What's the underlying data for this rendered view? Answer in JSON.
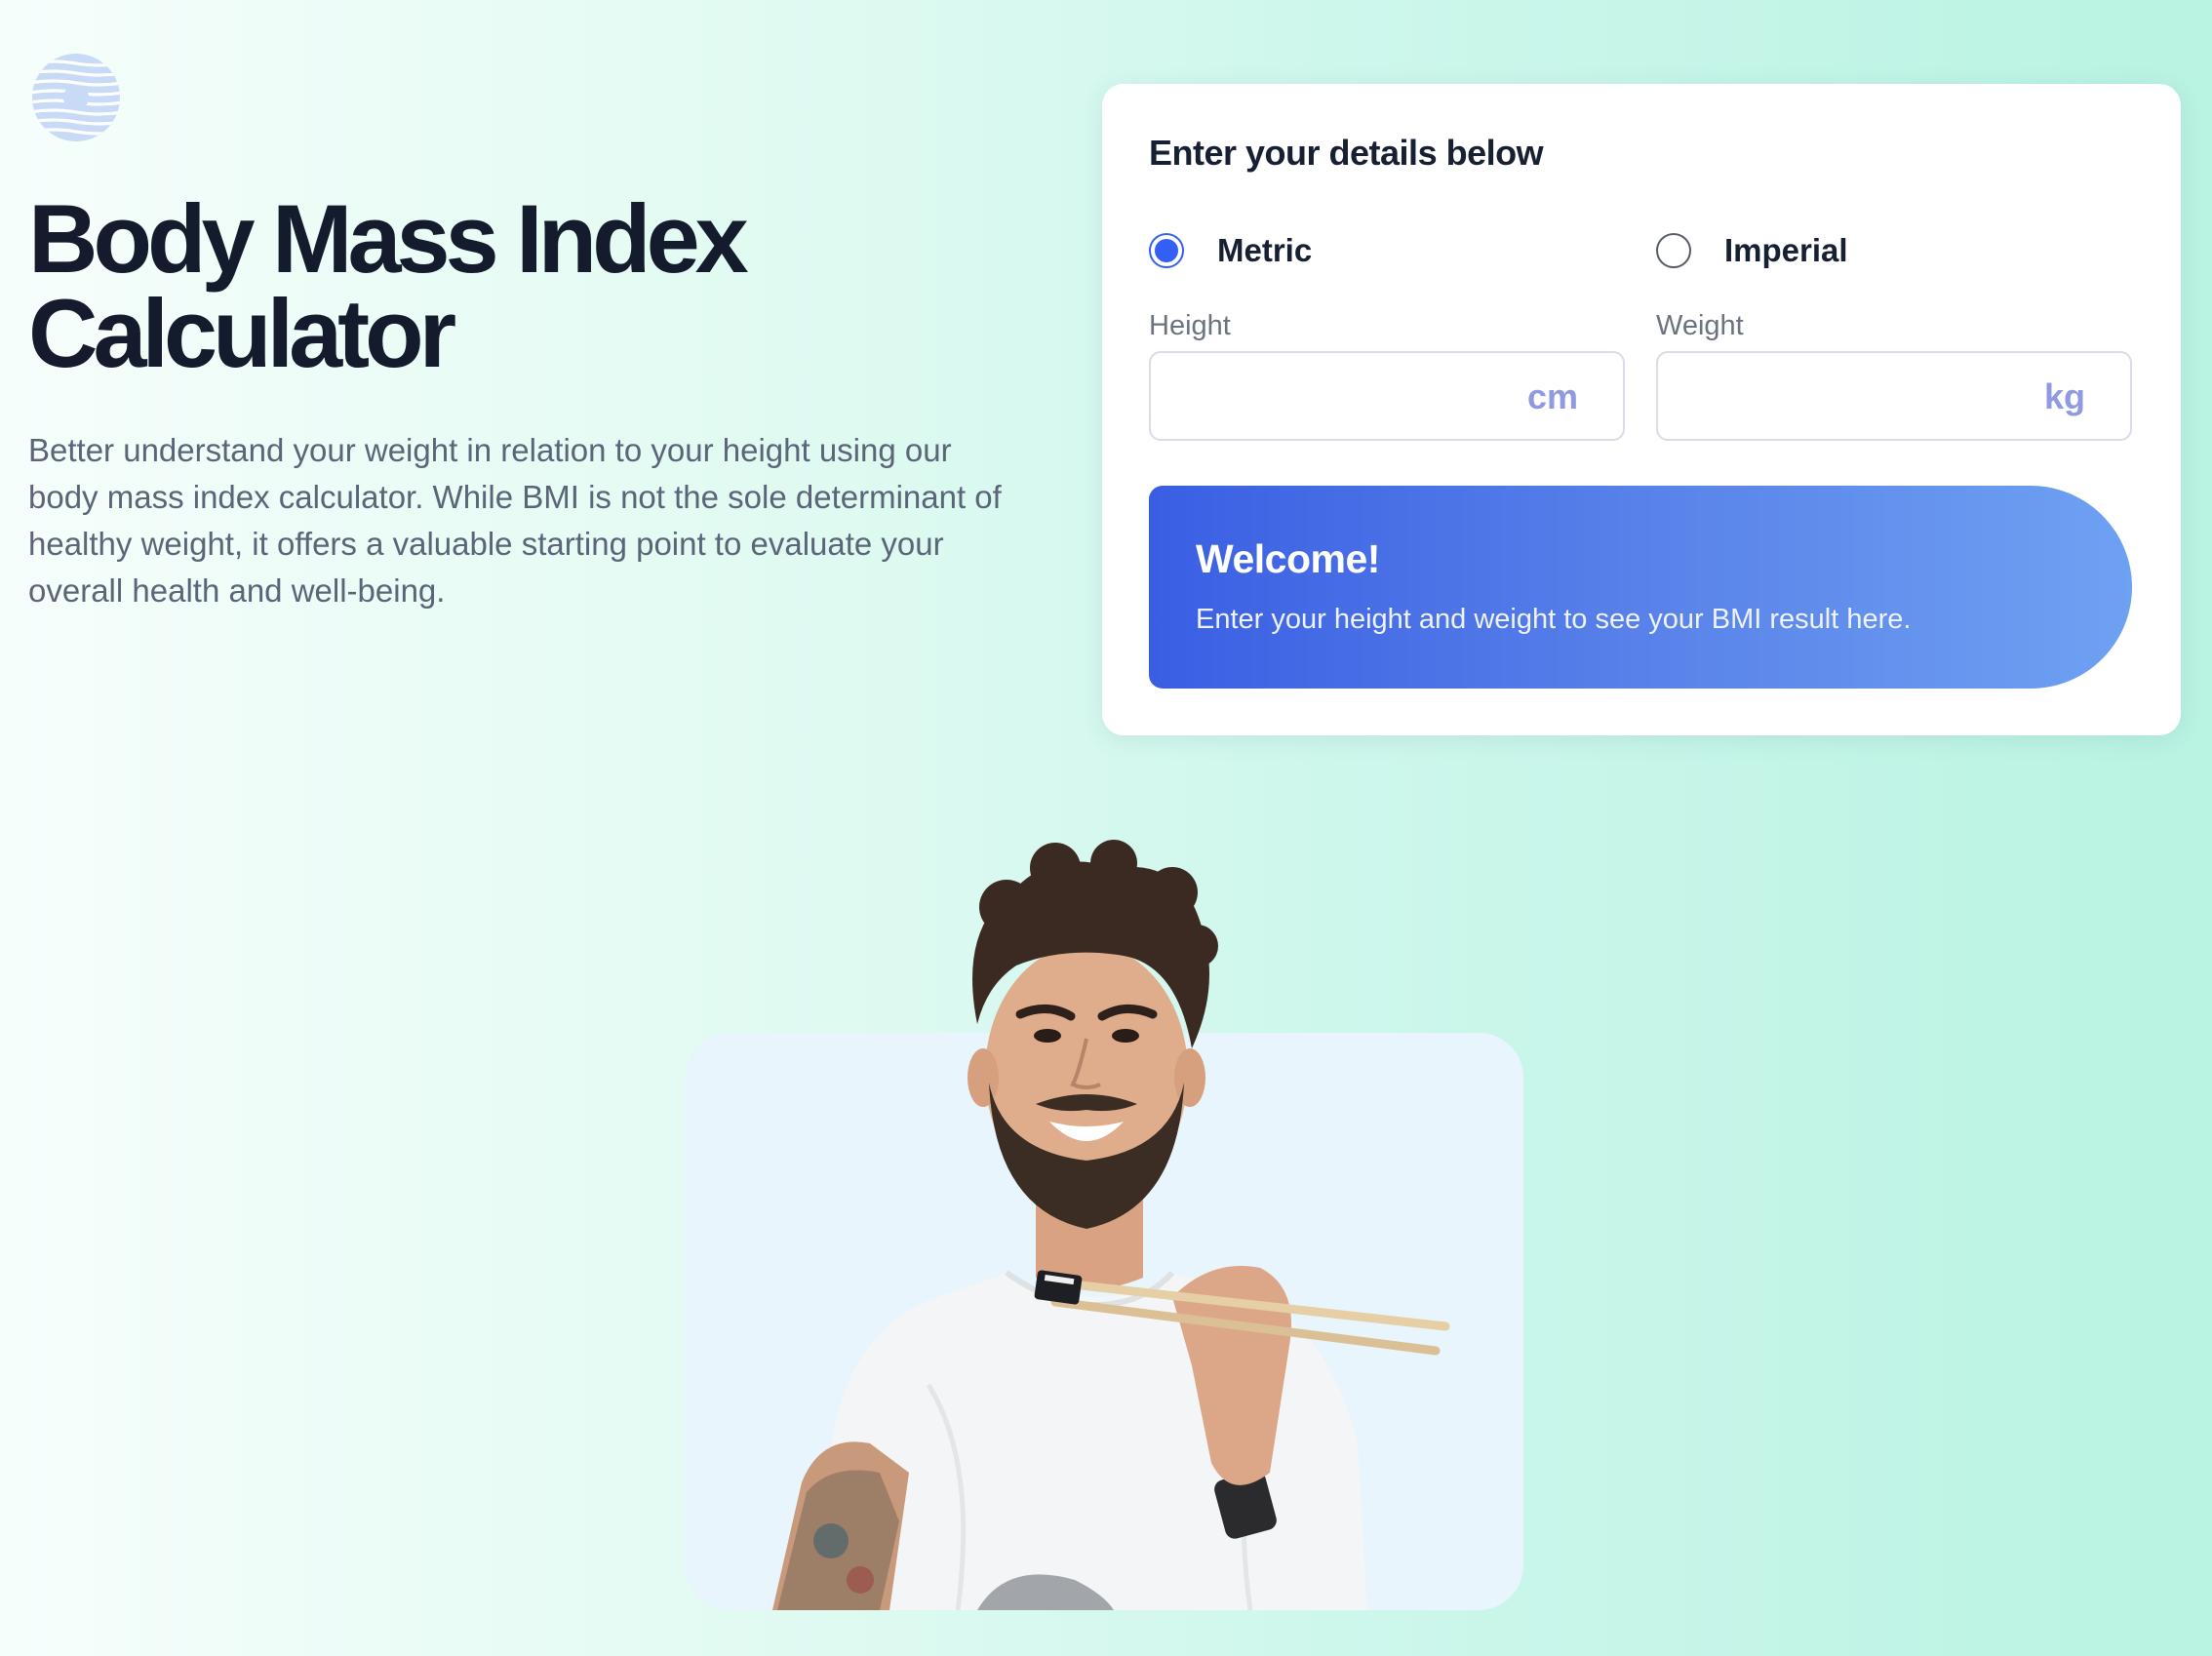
{
  "logo": {
    "icon": "striped-globe-logo-icon",
    "color": "#c7daf6"
  },
  "hero": {
    "title": "Body Mass Index Calculator",
    "description": "Better understand your weight in relation to your height using our body mass index calculator. While BMI is not the sole determinant of healthy weight, it offers a valuable starting point to evaluate your overall health and well-being."
  },
  "calculator": {
    "title": "Enter your details below",
    "units": {
      "metric_label": "Metric",
      "imperial_label": "Imperial",
      "selected": "Metric"
    },
    "height": {
      "label": "Height",
      "value": "",
      "unit": "cm"
    },
    "weight": {
      "label": "Weight",
      "value": "",
      "unit": "kg"
    },
    "result": {
      "title": "Welcome!",
      "text": "Enter your height and weight to see your BMI result here."
    }
  },
  "colors": {
    "accent": "#345ff6",
    "title_text": "#141b2d",
    "body_text": "#5b6578",
    "unit_text": "#8f9ae0"
  }
}
